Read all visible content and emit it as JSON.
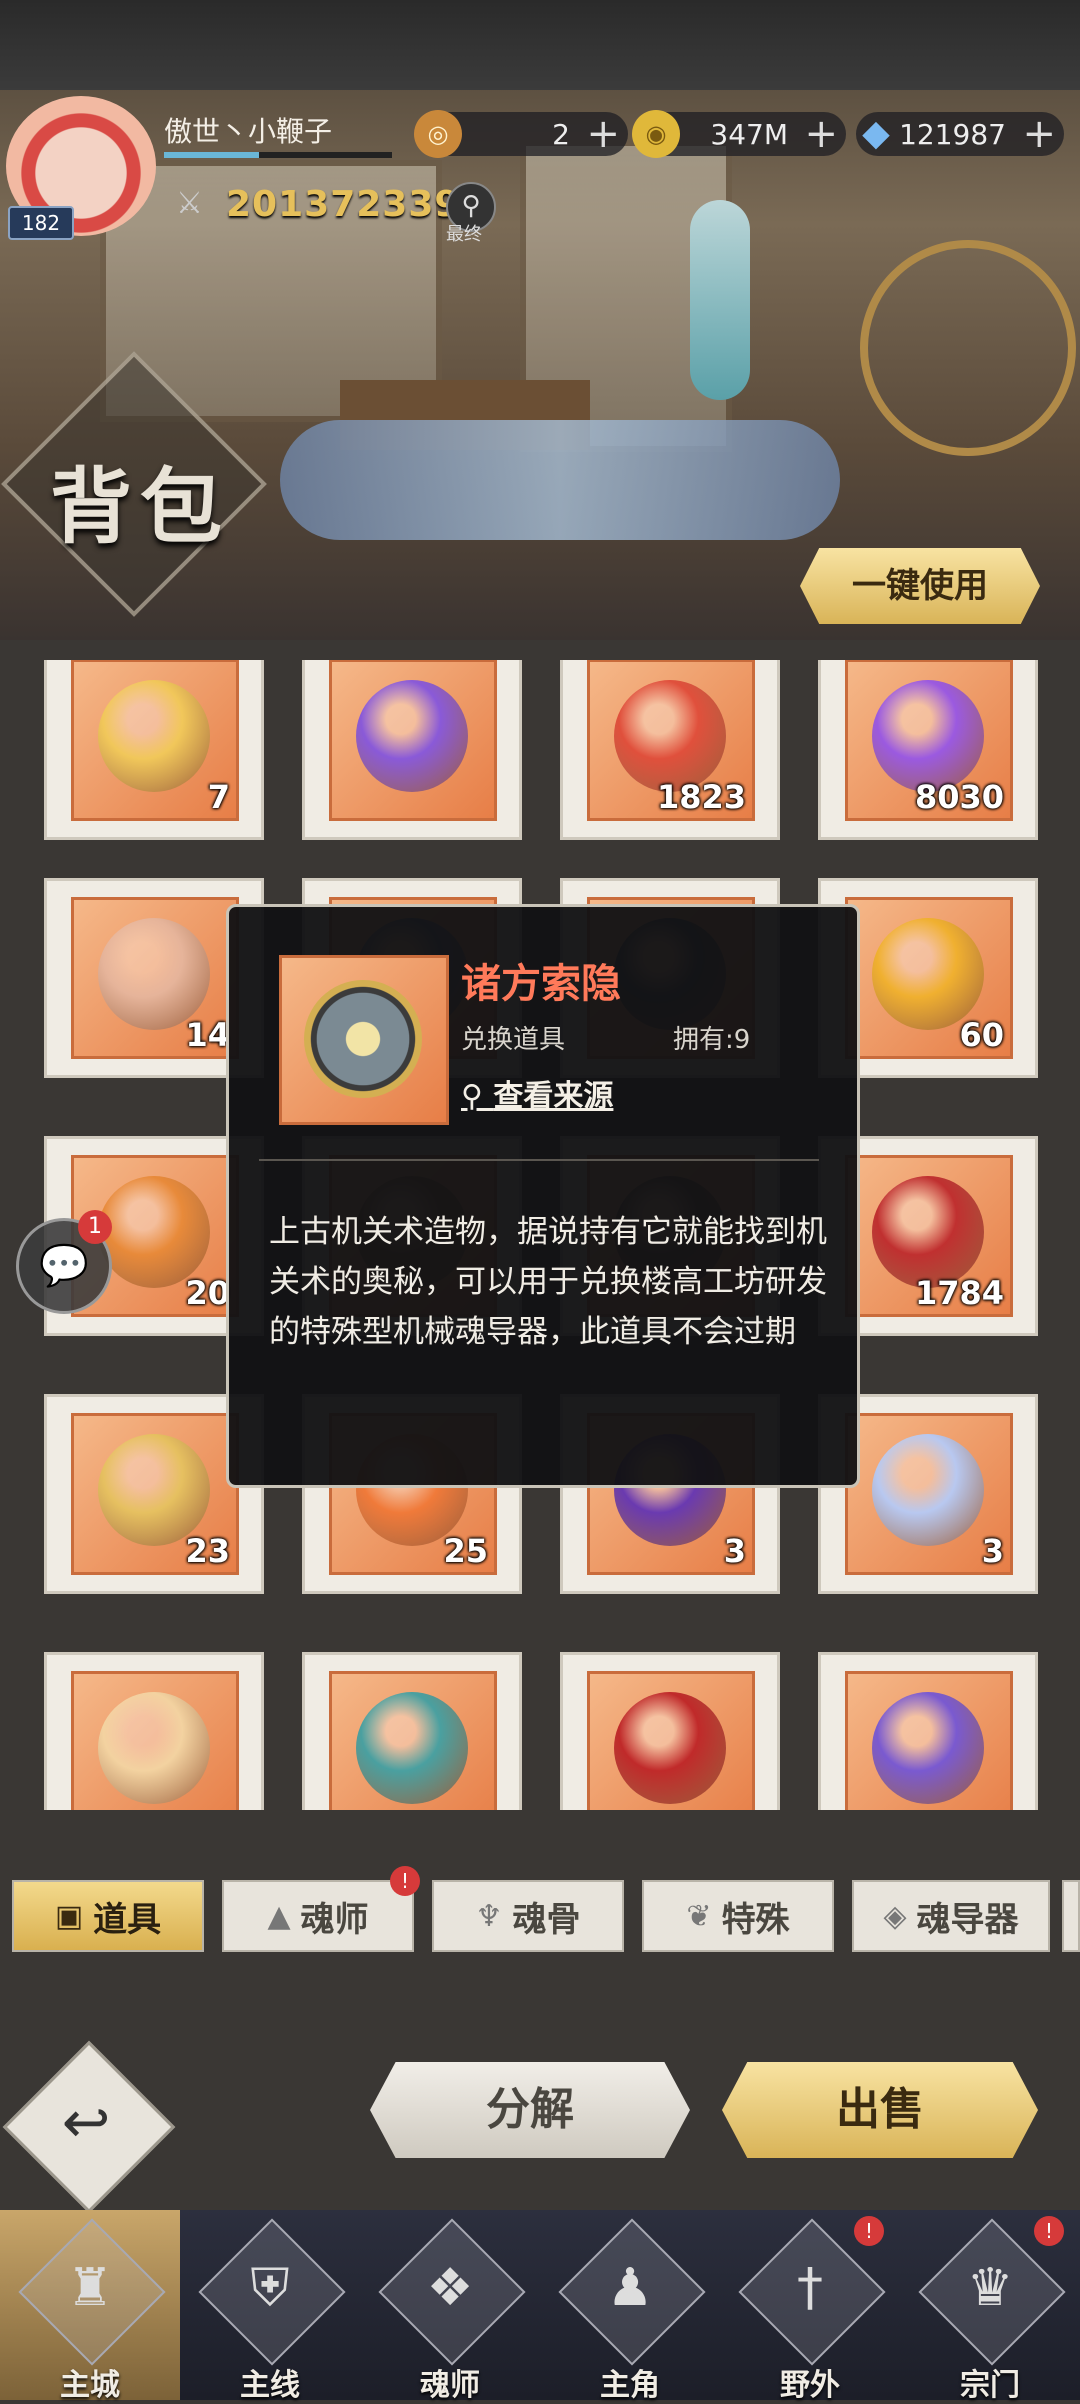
{
  "player": {
    "name": "傲世丶小鞭子",
    "level": "182",
    "power": "201372339",
    "power_tag": "最终"
  },
  "resources": [
    {
      "icon": "token-icon",
      "value": "2"
    },
    {
      "icon": "gold-coin-icon",
      "value": "347M"
    },
    {
      "icon": "diamond-icon",
      "value": "121987"
    }
  ],
  "page": {
    "title": "背包",
    "use_all_label": "一键使用"
  },
  "items": [
    {
      "count": "7",
      "color": "#f1c75a"
    },
    {
      "count": "",
      "color": "#8a5ad8"
    },
    {
      "count": "1823",
      "color": "#e0503c"
    },
    {
      "count": "8030",
      "color": "#9b5ae0"
    },
    {
      "count": "14",
      "color": "#e6b49a"
    },
    {
      "count": "",
      "color": "#5a6fa0"
    },
    {
      "count": "",
      "color": "#3a4a60"
    },
    {
      "count": "60",
      "color": "#f0b030"
    },
    {
      "count": "20",
      "color": "#e88a3a"
    },
    {
      "count": "",
      "color": "#9a6a40"
    },
    {
      "count": "",
      "color": "#6a5040"
    },
    {
      "count": "1784",
      "color": "#c03030"
    },
    {
      "count": "23",
      "color": "#e6c060"
    },
    {
      "count": "25",
      "color": "#f07a3a"
    },
    {
      "count": "3",
      "color": "#6a3ab0"
    },
    {
      "count": "3",
      "color": "#b8c8f0"
    },
    {
      "count": "",
      "color": "#f3d2a0"
    },
    {
      "count": "",
      "color": "#4aa0a0"
    },
    {
      "count": "",
      "color": "#c02a2a"
    },
    {
      "count": "",
      "color": "#7a5ad0"
    }
  ],
  "tooltip": {
    "name": "诸方索隐",
    "type": "兑换道具",
    "owned": "拥有:9",
    "source_link": "查看来源",
    "description": "上古机关术造物，据说持有它就能找到机关术的奥秘，可以用于兑换楼高工坊研发的特殊型机械魂导器，此道具不会过期"
  },
  "chat": {
    "badge": "1"
  },
  "tabs": [
    {
      "label": "道具",
      "icon": "box-icon",
      "active": true
    },
    {
      "label": "魂师",
      "icon": "hood-icon",
      "badge": "!"
    },
    {
      "label": "魂骨",
      "icon": "bone-icon"
    },
    {
      "label": "特殊",
      "icon": "feather-icon"
    },
    {
      "label": "魂导器",
      "icon": "device-icon"
    }
  ],
  "actions": {
    "decompose": "分解",
    "sell": "出售"
  },
  "nav": [
    {
      "label": "主城",
      "icon": "castle-icon",
      "active": true
    },
    {
      "label": "主线",
      "icon": "shield-icon"
    },
    {
      "label": "魂师",
      "icon": "book-icon"
    },
    {
      "label": "主角",
      "icon": "hooded-figure-icon"
    },
    {
      "label": "野外",
      "icon": "sword-icon",
      "badge": "!"
    },
    {
      "label": "宗门",
      "icon": "emblem-icon",
      "badge": "!"
    }
  ]
}
